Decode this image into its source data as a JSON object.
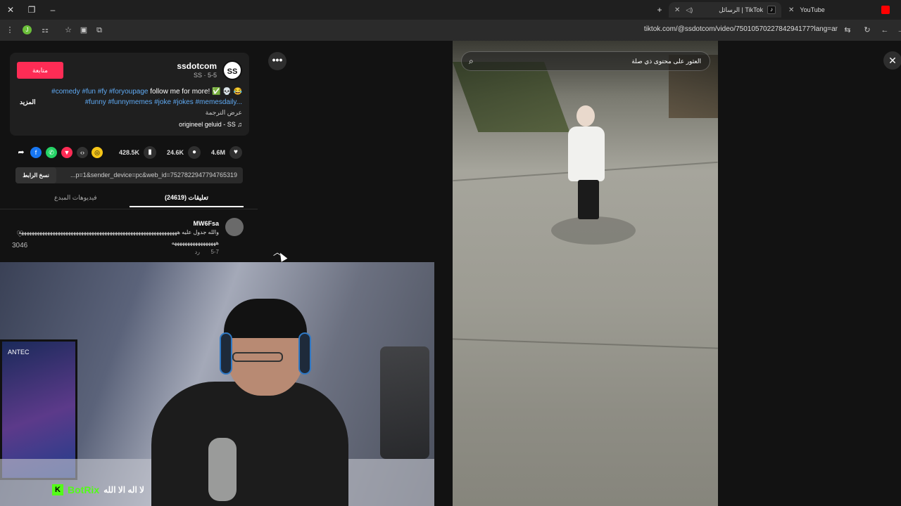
{
  "browser": {
    "tabs": [
      {
        "label": "YouTube",
        "active": false
      },
      {
        "label": "الرسائل | TikTok",
        "active": true
      }
    ],
    "url": "tiktok.com/@ssdotcom/video/7501057022784294177?lang=ar",
    "extension_badge": "J",
    "brand_colors": {
      "tiktok_red": "#fe2c55",
      "youtube_red": "#ff0000",
      "kick_green": "#53fc18"
    }
  },
  "post": {
    "follow_label": "متابعة",
    "author": "ssdotcom",
    "author_sub": "SS · 5-5",
    "avatar_text": "SS",
    "desc_line1_text": "follow me for more! ",
    "desc_line1_tags": "#comedy #fun #fy #foryoupage",
    "desc_line2": "#funny #funnymemes #joke #jokes #memesdaily...",
    "more_label": "المزيد",
    "translate_label": "عرض الترجمة",
    "sound": "origineel geluid - SS"
  },
  "stats": {
    "likes": "4.6M",
    "comments": "24.6K",
    "saves": "428.5K"
  },
  "link": {
    "copy_label": "نسخ الرابط",
    "value": "...p=1&sender_device=pc&web_id=7527822947794765319"
  },
  "panel_tabs": {
    "comments_label": "تعليقات (24619)",
    "creator_videos_label": "فيديوهات المبدع"
  },
  "comment": {
    "user": "MW6Fsa",
    "text1": "والله جدول عليه هههههههههههههههههههههههههههههههههههههههههههههههههههههههههههههه",
    "text2": "هههههههههههههههههه",
    "date": "5-7",
    "reply": "رد",
    "likes": "3046"
  },
  "video": {
    "search_placeholder": "العثور على محتوى ذي صلة"
  },
  "stream": {
    "bot_name": "BotRix",
    "caption": "لا اله الا الله",
    "pc_brand": "ANTEC"
  }
}
